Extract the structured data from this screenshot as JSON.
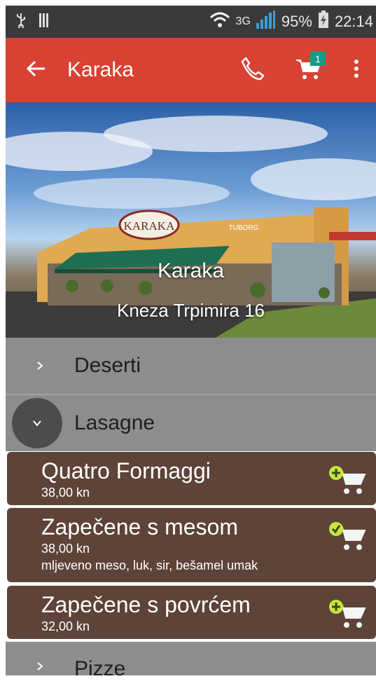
{
  "status": {
    "network": "3G",
    "battery": "95%",
    "time": "22:14"
  },
  "appbar": {
    "title": "Karaka",
    "cart_count": "1"
  },
  "hero": {
    "name": "Karaka",
    "address": "Kneza Trpimira 16",
    "sign_text": "KARAKA",
    "building_text": "TUBORG"
  },
  "categories": [
    {
      "name": "Deserti",
      "expanded": false
    },
    {
      "name": "Lasagne",
      "expanded": true
    },
    {
      "name": "Pizze",
      "expanded": false
    }
  ],
  "items": [
    {
      "name": "Quatro Formaggi",
      "price": "38,00 kn",
      "description": ""
    },
    {
      "name": "Zapečene s mesom",
      "price": "38,00 kn",
      "description": "mljeveno meso, luk, sir, bešamel umak"
    },
    {
      "name": "Zapečene s povrćem",
      "price": "32,00 kn",
      "description": ""
    }
  ],
  "colors": {
    "app_bar": "#d84232",
    "status_bar": "#3a3a3a",
    "category_bg": "#8d8d8d",
    "item_bg": "#5e4338",
    "badge": "#189a8a",
    "add_icon": "#c6e63a"
  },
  "icons": {
    "back": "arrow-left-icon",
    "phone": "phone-icon",
    "cart": "cart-icon",
    "menu": "more-vertical-icon",
    "add_to_cart": "cart-add-icon"
  }
}
